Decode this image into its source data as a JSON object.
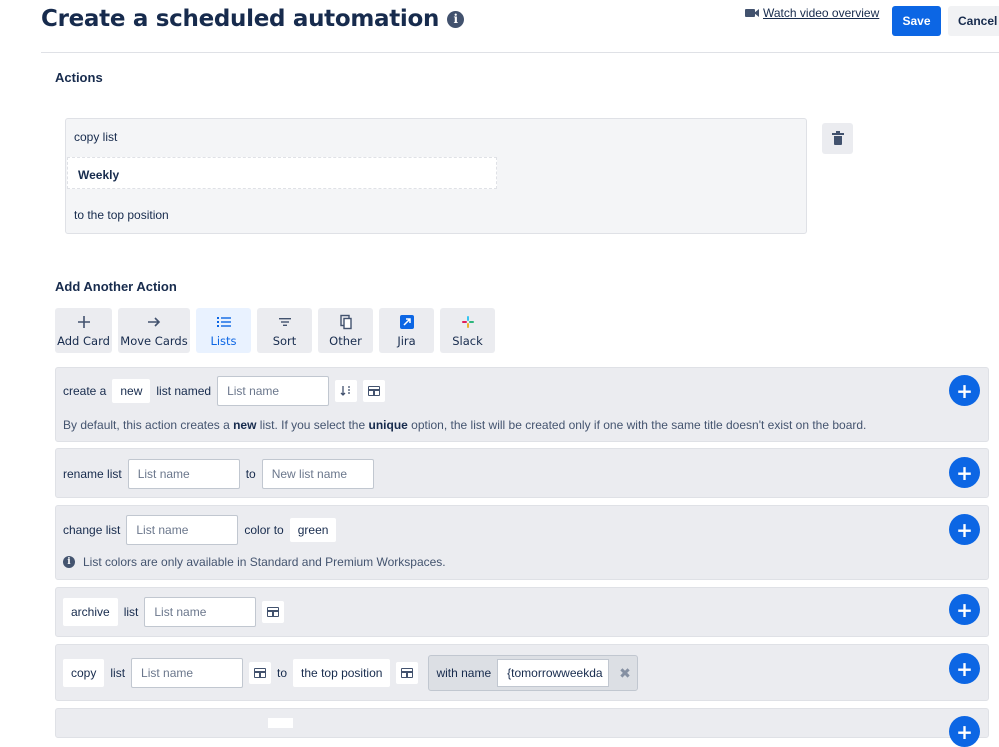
{
  "header": {
    "title": "Create a scheduled automation",
    "info_icon": "info-icon",
    "watch_video": "Watch video overview",
    "save": "Save",
    "cancel": "Cancel"
  },
  "actions_section": {
    "heading": "Actions",
    "existing_action": {
      "line1": "copy list",
      "list_name": "Weekly",
      "line3": "to the top position"
    },
    "delete_icon": "trash-icon"
  },
  "add_another": {
    "heading": "Add Another Action",
    "tabs": [
      {
        "label": "Add Card",
        "icon": "plus-icon"
      },
      {
        "label": "Move Cards",
        "icon": "arrow-right-icon"
      },
      {
        "label": "Lists",
        "icon": "list-icon",
        "active": true
      },
      {
        "label": "Sort",
        "icon": "sort-icon"
      },
      {
        "label": "Other",
        "icon": "copy-icon"
      },
      {
        "label": "Jira",
        "icon": "jira-icon"
      },
      {
        "label": "Slack",
        "icon": "slack-icon"
      }
    ]
  },
  "rows": {
    "create": {
      "prefix": "create a",
      "chip": "new",
      "middle": "list named",
      "placeholder": "List name",
      "help_pre": "By default, this action creates a ",
      "help_bold1": "new",
      "help_mid": " list. If you select the ",
      "help_bold2": "unique",
      "help_post": " option, the list will be created only if one with the same title doesn't exist on the board."
    },
    "rename": {
      "prefix": "rename list",
      "placeholder": "List name",
      "to": "to",
      "new_placeholder": "New list name"
    },
    "change": {
      "prefix": "change list",
      "placeholder": "List name",
      "color_to": "color to",
      "color": "green",
      "note": "List colors are only available in Standard and Premium Workspaces."
    },
    "archive": {
      "chip": "archive",
      "list": "list",
      "placeholder": "List name"
    },
    "copy": {
      "chip": "copy",
      "list": "list",
      "placeholder": "List name",
      "to": "to",
      "position": "the top position",
      "with_name": "with name",
      "name_value": "{tomorrowweekda"
    }
  }
}
